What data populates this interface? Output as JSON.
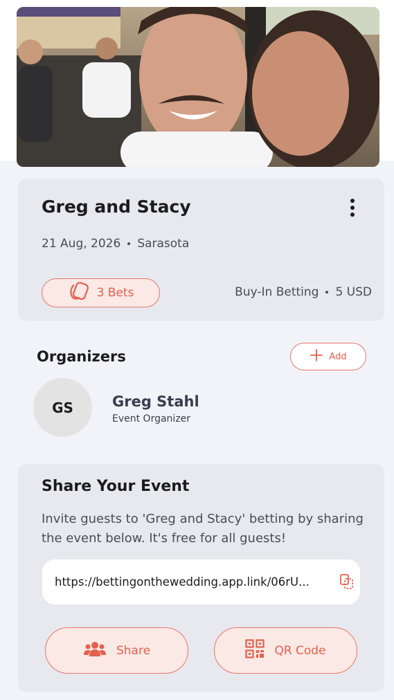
{
  "event": {
    "title": "Greg and Stacy",
    "date": "21 Aug, 2026",
    "location": "Sarasota",
    "bets_label": "3 Bets",
    "betting_type": "Buy-In Betting",
    "buy_in": "5 USD"
  },
  "organizers": {
    "heading": "Organizers",
    "add_label": "Add",
    "items": [
      {
        "initials": "GS",
        "name": "Greg Stahl",
        "role": "Event Organizer"
      }
    ]
  },
  "share": {
    "title": "Share Your Event",
    "description": "Invite guests to 'Greg and Stacy' betting by sharing the event below. It's free for all guests!",
    "link": "https://bettingonthewedding.app.link/06rU...",
    "share_label": "Share",
    "qr_label": "QR Code"
  },
  "colors": {
    "accent": "#e3604f",
    "accent_light": "#fbe9e6",
    "card_bg": "#e8e9ef",
    "page_bg": "#f2f3f8"
  },
  "icons": {
    "more": "more-vertical-icon",
    "bets": "bets-icon",
    "add": "plus-icon",
    "copy": "copy-icon",
    "share": "people-icon",
    "qr": "qr-code-icon"
  }
}
